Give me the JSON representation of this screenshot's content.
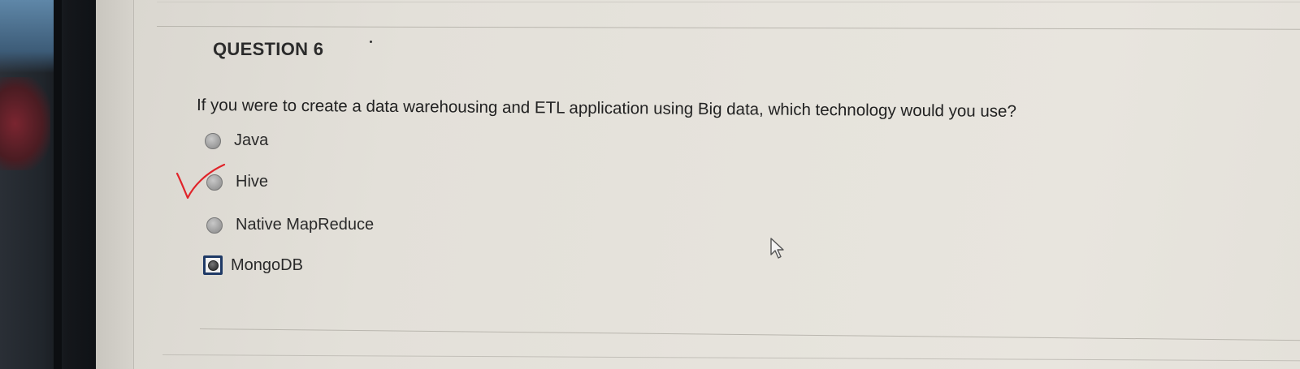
{
  "question": {
    "title": "QUESTION 6",
    "text": "If you were to create a data warehousing and ETL application using Big data, which technology would you use?"
  },
  "options": [
    {
      "label": "Java",
      "selected": false
    },
    {
      "label": "Hive",
      "selected": false,
      "annotated_correct": true
    },
    {
      "label": "Native MapReduce",
      "selected": false
    },
    {
      "label": "MongoDB",
      "selected": true
    }
  ],
  "colors": {
    "annotation_check": "#e0242a",
    "selected_border": "#1f3a66",
    "page_background": "#e6e3dc"
  },
  "icons": {
    "annotation": "handwritten-checkmark-icon",
    "pointer": "mouse-cursor-icon"
  }
}
